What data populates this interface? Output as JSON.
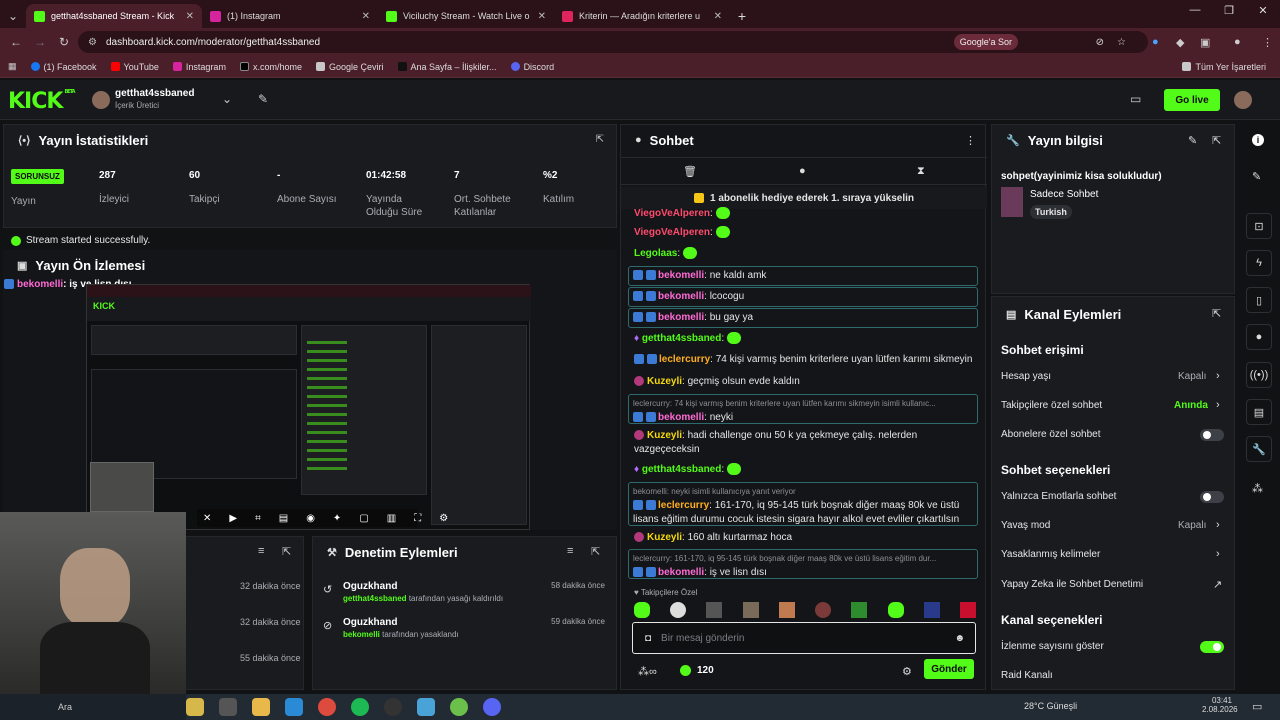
{
  "browser": {
    "tabs": [
      {
        "title": "getthat4ssbaned Stream - Kick",
        "color": "#53fc18"
      },
      {
        "title": "(1) Instagram",
        "color": "#d6249f"
      },
      {
        "title": "Viciluchy Stream - Watch Live o",
        "color": "#53fc18"
      },
      {
        "title": "Kriterin — Aradığın kriterlere u",
        "color": "#e0245e"
      }
    ],
    "url": "dashboard.kick.com/moderator/getthat4ssbaned",
    "google_btn": "Google'a Sor",
    "bookmarks": [
      "(1) Facebook",
      "YouTube",
      "Instagram",
      "x.com/home",
      "Google Çeviri",
      "Ana Sayfa – İlişkiler...",
      "Discord"
    ],
    "bookmark_all": "Tüm Yer İşaretleri"
  },
  "header": {
    "logo": "KICK",
    "beta": "BETA",
    "username": "getthat4ssbaned",
    "role": "İçerik Üretici",
    "go_live": "Go live"
  },
  "stats": {
    "title": "Yayın İstatistikleri",
    "badge": "SORUNSUZ",
    "badge_label": "Yayın",
    "items": [
      {
        "value": "287",
        "label": "İzleyici"
      },
      {
        "value": "60",
        "label": "Takipçi"
      },
      {
        "value": "-",
        "label": "Abone Sayısı"
      },
      {
        "value": "01:42:58",
        "label": "Yayında Olduğu Süre"
      },
      {
        "value": "7",
        "label": "Ort. Sohbete Katılanlar"
      },
      {
        "value": "%2",
        "label": "Katılım"
      }
    ],
    "success": "Stream started successfully."
  },
  "preview": {
    "title": "Yayın Ön İzlemesi",
    "overlay_user": "bekomelli",
    "overlay_msg": ": iş ve lisn dısı"
  },
  "left_log": [
    {
      "time": "32 dakika önce"
    },
    {
      "time": "32 dakika önce"
    },
    {
      "time": "55 dakika önce"
    }
  ],
  "mod_actions": {
    "title": "Denetim Eylemleri",
    "items": [
      {
        "user": "Oguzkhand",
        "actor": "getthat4ssbaned",
        "action": "tarafından yasağı kaldırıldı",
        "time": "58 dakika önce"
      },
      {
        "user": "Oguzkhand",
        "actor": "bekomelli",
        "action": "tarafından yasaklandı",
        "time": "59 dakika önce"
      }
    ]
  },
  "chat": {
    "title": "Sohbet",
    "promo": "1 abonelik hediye ederek 1. sıraya yükselin",
    "messages": [
      {
        "user": "ViegoVeAlperen",
        "color": "#ff4a6e",
        "text": ""
      },
      {
        "user": "ViegoVeAlperen",
        "color": "#ff4a6e",
        "text": ""
      },
      {
        "user": "Legolaas",
        "color": "#53fc18",
        "text": ""
      },
      {
        "user": "bekomelli",
        "color": "#ff6ad5",
        "text": "ne kaldı amk"
      },
      {
        "user": "bekomelli",
        "color": "#ff6ad5",
        "text": "lcocogu"
      },
      {
        "user": "bekomelli",
        "color": "#ff6ad5",
        "text": "bu gay ya"
      },
      {
        "user": "getthat4ssbaned",
        "color": "#53fc18",
        "text": ""
      },
      {
        "user": "leclercurry",
        "color": "#ffb020",
        "text": "74 kişi varmış benim kriterlere uyan lütfen karımı sikmeyin"
      },
      {
        "user": "Kuzeyli",
        "color": "#f5d90a",
        "text": "geçmiş olsun evde kaldın"
      },
      {
        "reply": "leclercurry: 74 kişi varmış benim kriterlere uyan lütfen karımı sikmeyin isimli kullanıc...",
        "user": "bekomelli",
        "color": "#ff6ad5",
        "text": "neyki"
      },
      {
        "user": "Kuzeyli",
        "color": "#f5d90a",
        "text": "hadi challenge onu 50 k ya çekmeye çalış. nelerden vazgeçeceksin"
      },
      {
        "user": "getthat4ssbaned",
        "color": "#53fc18",
        "text": ""
      },
      {
        "reply": "bekomelli: neyki isimli kullanıcıya yanıt veriyor",
        "user": "leclercurry",
        "color": "#ffb020",
        "text": "161-170, iq 95-145 türk boşnak diğer maaş 80k ve üstü lisans eğitim durumu cocuk istesin sigara hayır alkol evet evliler çıkartılsın"
      },
      {
        "user": "Kuzeyli",
        "color": "#f5d90a",
        "text": "160 altı kurtarmaz hoca"
      },
      {
        "reply": "leclercurry: 161-170, iq 95-145 türk boşnak diğer maaş 80k ve üstü lisans eğitim dur...",
        "user": "bekomelli",
        "color": "#ff6ad5",
        "text": "iş ve lisn dısı"
      }
    ],
    "emote_label": "Takipçilere Özel",
    "input_placeholder": "Bir mesaj gönderin",
    "points": "120",
    "send": "Gönder"
  },
  "stream_info": {
    "title": "Yayın bilgisi",
    "stream_title": "sohpet(yayinimiz kisa solukludur)",
    "category": "Sadece Sohbet",
    "tag": "Turkish"
  },
  "channel_actions": {
    "title": "Kanal Eylemleri",
    "chat_access": "Sohbet erişimi",
    "rows": [
      {
        "label": "Hesap yaşı",
        "value": "Kapalı"
      },
      {
        "label": "Takipçilere özel sohbet",
        "value": "Anında"
      },
      {
        "label": "Abonelere özel sohbet",
        "value": ""
      }
    ],
    "chat_options": "Sohbet seçenekleri",
    "option_rows": [
      {
        "label": "Yalnızca Emotlarla sohbet",
        "value": ""
      },
      {
        "label": "Yavaş mod",
        "value": "Kapalı"
      },
      {
        "label": "Yasaklanmış kelimeler",
        "value": ""
      },
      {
        "label": "Yapay Zeka ile Sohbet Denetimi",
        "value": ""
      }
    ],
    "channel_options": "Kanal seçenekleri",
    "channel_rows": [
      {
        "label": "İzlenme sayısını göster"
      },
      {
        "label": "Raid Kanalı"
      }
    ]
  },
  "taskbar": {
    "weather": "28°C  Güneşli",
    "time": "03:41",
    "date": "2.08.2026",
    "search": "Ara"
  }
}
